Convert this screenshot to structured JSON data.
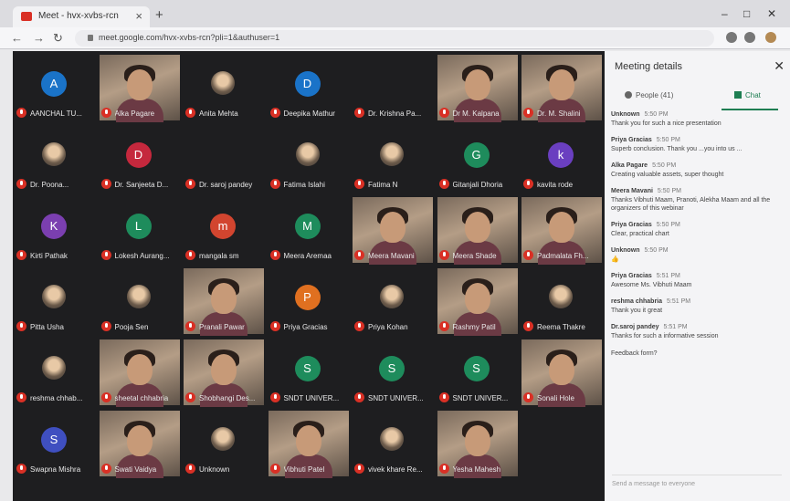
{
  "browser": {
    "tab_title": "Meet - hvx-xvbs-rcn",
    "new_tab": "+",
    "url": "meet.google.com/hvx-xvbs-rcn?pli=1&authuser=1",
    "window_controls": [
      "–",
      "□",
      "✕"
    ]
  },
  "participants": [
    {
      "type": "avatar",
      "initial": "A",
      "color": "#1a73c8",
      "name": "AANCHAL TU..."
    },
    {
      "type": "video",
      "name": "Alka Pagare"
    },
    {
      "type": "photo",
      "name": "Anita Mehta"
    },
    {
      "type": "avatar",
      "initial": "D",
      "color": "#1a73c8",
      "name": "Deepika Mathur"
    },
    {
      "type": "empty",
      "name": "Dr. Krishna Pa..."
    },
    {
      "type": "video",
      "name": "Dr M. Kalpana"
    },
    {
      "type": "video",
      "name": "Dr. M. Shalini"
    },
    {
      "type": "photo",
      "name": "Dr. Poona..."
    },
    {
      "type": "avatar",
      "initial": "D",
      "color": "#c5283d",
      "name": "Dr. Sanjeeta D..."
    },
    {
      "type": "empty",
      "name": "Dr. saroj pandey"
    },
    {
      "type": "photo",
      "name": "Fatima Islahi"
    },
    {
      "type": "photo",
      "name": "Fatima N"
    },
    {
      "type": "avatar",
      "initial": "G",
      "color": "#1e8c5c",
      "name": "Gitanjali Dhoria"
    },
    {
      "type": "avatar",
      "initial": "k",
      "color": "#6a3fc0",
      "name": "kavita rode"
    },
    {
      "type": "avatar",
      "initial": "K",
      "color": "#7b3fb0",
      "name": "Kirti Pathak"
    },
    {
      "type": "avatar",
      "initial": "L",
      "color": "#1e8c5c",
      "name": "Lokesh Aurang..."
    },
    {
      "type": "avatar",
      "initial": "m",
      "color": "#d2452f",
      "name": "mangala sm"
    },
    {
      "type": "avatar",
      "initial": "M",
      "color": "#1e8c5c",
      "name": "Meera Aremaa"
    },
    {
      "type": "video",
      "name": "Meera Mavani"
    },
    {
      "type": "video",
      "name": "Meera Shade"
    },
    {
      "type": "video",
      "name": "Padmalata Fh..."
    },
    {
      "type": "photo",
      "name": "Pitta Usha"
    },
    {
      "type": "photo",
      "name": "Pooja Sen"
    },
    {
      "type": "video",
      "name": "Pranali Pawar"
    },
    {
      "type": "avatar",
      "initial": "P",
      "color": "#e07020",
      "name": "Priya Gracias"
    },
    {
      "type": "photo",
      "name": "Priya Kohan"
    },
    {
      "type": "video",
      "name": "Rashmy Patil"
    },
    {
      "type": "photo",
      "name": "Reema Thakre"
    },
    {
      "type": "photo",
      "name": "reshma chhab..."
    },
    {
      "type": "video",
      "name": "sheetal chhabria"
    },
    {
      "type": "video",
      "name": "Shobhangi Des..."
    },
    {
      "type": "avatar",
      "initial": "S",
      "color": "#1e8c5c",
      "name": "SNDT UNIVER..."
    },
    {
      "type": "avatar",
      "initial": "S",
      "color": "#1e8c5c",
      "name": "SNDT UNIVER..."
    },
    {
      "type": "avatar",
      "initial": "S",
      "color": "#1e8c5c",
      "name": "SNDT UNIVER..."
    },
    {
      "type": "video",
      "name": "Sonali Hole"
    },
    {
      "type": "avatar",
      "initial": "S",
      "color": "#3f4fc0",
      "name": "Swapna Mishra"
    },
    {
      "type": "video",
      "name": "Swati Vaidya"
    },
    {
      "type": "photo",
      "name": "Unknown"
    },
    {
      "type": "video",
      "name": "Vibhuti Patel"
    },
    {
      "type": "photo",
      "name": "vivek khare Re..."
    },
    {
      "type": "video",
      "name": "Yesha Mahesh"
    }
  ],
  "panel": {
    "title": "Meeting details",
    "close": "✕",
    "people_tab": "People (41)",
    "chat_tab": "Chat",
    "compose_placeholder": "Send a message to everyone",
    "messages": [
      {
        "sender": "Unknown",
        "time": "5:50 PM",
        "text": "Thank you for such a nice presentation"
      },
      {
        "sender": "Priya Gracias",
        "time": "5:50 PM",
        "text": "Superb conclusion. Thank you ...you into us ..."
      },
      {
        "sender": "Alka Pagare",
        "time": "5:50 PM",
        "text": "Creating valuable assets, super thought"
      },
      {
        "sender": "Meera Mavani",
        "time": "5:50 PM",
        "text": "Thanks Vibhuti Maam, Pranoti, Alekha Maam and all the organizers of this webinar"
      },
      {
        "sender": "Priya Gracias",
        "time": "5:50 PM",
        "text": "Clear, practical chart"
      },
      {
        "sender": "Unknown",
        "time": "5:50 PM",
        "text": "👍"
      },
      {
        "sender": "Priya Gracias",
        "time": "5:51 PM",
        "text": "Awesome Ms. Vibhuti Maam"
      },
      {
        "sender": "reshma chhabria",
        "time": "5:51 PM",
        "text": "Thank you it great"
      },
      {
        "sender": "Dr.saroj pandey",
        "time": "5:51 PM",
        "text": "Thanks for such a informative session"
      },
      {
        "sender": "",
        "time": "",
        "text": "Feedback form?"
      }
    ]
  }
}
